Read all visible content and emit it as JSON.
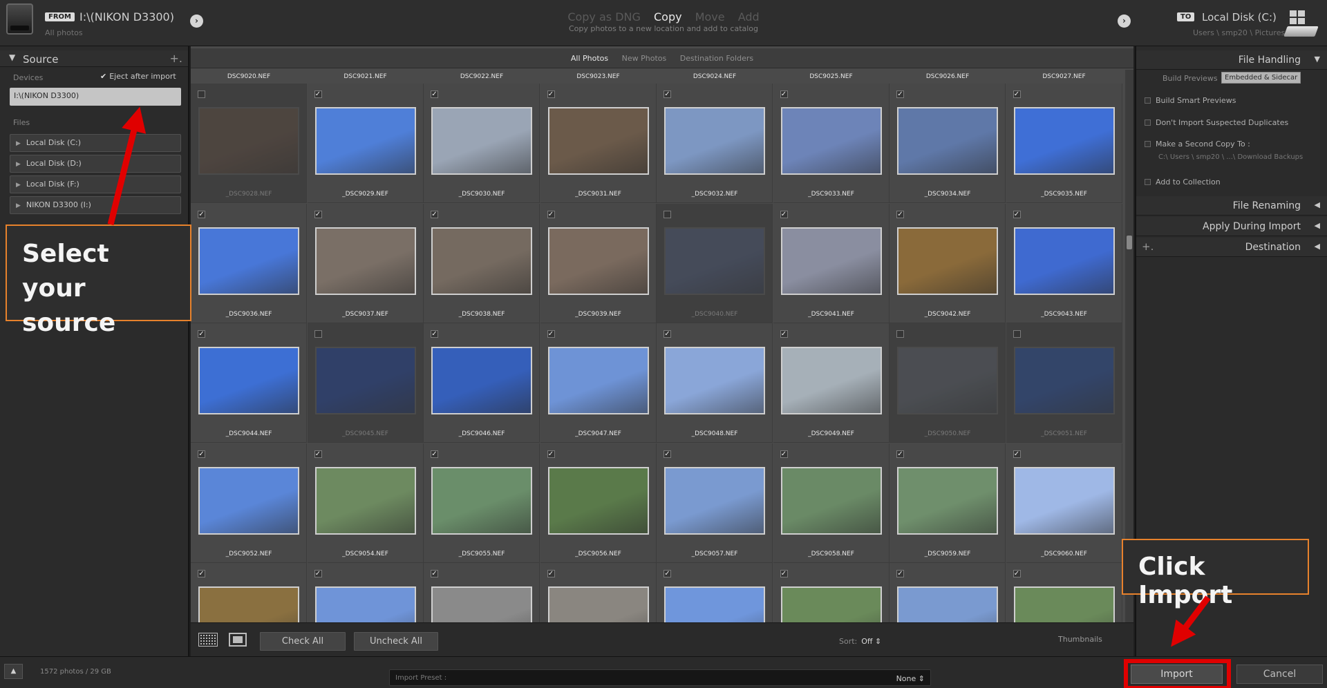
{
  "header": {
    "from_badge": "FROM",
    "from_path": "I:\\(NIKON D3300)",
    "from_sub": "All photos",
    "modes": [
      {
        "label": "Copy as DNG",
        "active": false
      },
      {
        "label": "Copy",
        "active": true
      },
      {
        "label": "Move",
        "active": false
      },
      {
        "label": "Add",
        "active": false
      }
    ],
    "mode_description": "Copy photos to a new location and add to catalog",
    "to_badge": "TO",
    "to_path": "Local Disk (C:)",
    "to_sub": "Users \\ smp20 \\ Pictures"
  },
  "source_panel": {
    "title": "Source",
    "devices_label": "Devices",
    "eject_label": "Eject after import",
    "eject_checked": true,
    "selected_device": "I:\\(NIKON D3300)",
    "files_label": "Files",
    "files": [
      "Local Disk (C:)",
      "Local Disk (D:)",
      "Local Disk (F:)",
      "NIKON D3300 (I:)"
    ]
  },
  "filter_tabs": [
    {
      "label": "All Photos",
      "active": true
    },
    {
      "label": "New Photos",
      "active": false
    },
    {
      "label": "Destination Folders",
      "active": false
    }
  ],
  "grid": {
    "top_row_names": [
      "DSC9020.NEF",
      "DSC9021.NEF",
      "DSC9022.NEF",
      "DSC9023.NEF",
      "DSC9024.NEF",
      "DSC9025.NEF",
      "DSC9026.NEF",
      "DSC9027.NEF"
    ],
    "rows": [
      [
        {
          "name": "_DSC9028.NEF",
          "checked": false,
          "color": "#5a4a40"
        },
        {
          "name": "_DSC9029.NEF",
          "checked": true,
          "color": "#4f7fd8"
        },
        {
          "name": "_DSC9030.NEF",
          "checked": true,
          "color": "#9aa5b5"
        },
        {
          "name": "_DSC9031.NEF",
          "checked": true,
          "color": "#6b5a4a"
        },
        {
          "name": "_DSC9032.NEF",
          "checked": true,
          "color": "#7d97c2"
        },
        {
          "name": "_DSC9033.NEF",
          "checked": true,
          "color": "#6d84b8"
        },
        {
          "name": "_DSC9034.NEF",
          "checked": true,
          "color": "#5f78a8"
        },
        {
          "name": "_DSC9035.NEF",
          "checked": true,
          "color": "#3f6fd6"
        }
      ],
      [
        {
          "name": "_DSC9036.NEF",
          "checked": true,
          "color": "#4877d8"
        },
        {
          "name": "_DSC9037.NEF",
          "checked": true,
          "color": "#7a6f66"
        },
        {
          "name": "_DSC9038.NEF",
          "checked": true,
          "color": "#756a60"
        },
        {
          "name": "_DSC9039.NEF",
          "checked": true,
          "color": "#7a6a5e"
        },
        {
          "name": "_DSC9040.NEF",
          "checked": false,
          "color": "#4a5570"
        },
        {
          "name": "_DSC9041.NEF",
          "checked": true,
          "color": "#8a8ea0"
        },
        {
          "name": "_DSC9042.NEF",
          "checked": true,
          "color": "#8a6a3a"
        },
        {
          "name": "_DSC9043.NEF",
          "checked": true,
          "color": "#3f6ad0"
        }
      ],
      [
        {
          "name": "_DSC9044.NEF",
          "checked": true,
          "color": "#3d6fd4"
        },
        {
          "name": "_DSC9045.NEF",
          "checked": false,
          "color": "#24418a"
        },
        {
          "name": "_DSC9046.NEF",
          "checked": true,
          "color": "#355fba"
        },
        {
          "name": "_DSC9047.NEF",
          "checked": true,
          "color": "#6e93d6"
        },
        {
          "name": "_DSC9048.NEF",
          "checked": true,
          "color": "#8aa6d8"
        },
        {
          "name": "_DSC9049.NEF",
          "checked": true,
          "color": "#a6b0b8"
        },
        {
          "name": "_DSC9050.NEF",
          "checked": false,
          "color": "#555a62"
        },
        {
          "name": "_DSC9051.NEF",
          "checked": false,
          "color": "#2a4a8c"
        }
      ],
      [
        {
          "name": "_DSC9052.NEF",
          "checked": true,
          "color": "#5a86d8"
        },
        {
          "name": "_DSC9054.NEF",
          "checked": true,
          "color": "#6d8a60"
        },
        {
          "name": "_DSC9055.NEF",
          "checked": true,
          "color": "#6a8e6a"
        },
        {
          "name": "_DSC9056.NEF",
          "checked": true,
          "color": "#5a7a4a"
        },
        {
          "name": "_DSC9057.NEF",
          "checked": true,
          "color": "#7a9ad0"
        },
        {
          "name": "_DSC9058.NEF",
          "checked": true,
          "color": "#6a8a66"
        },
        {
          "name": "_DSC9059.NEF",
          "checked": true,
          "color": "#6f8f6c"
        },
        {
          "name": "_DSC9060.NEF",
          "checked": true,
          "color": "#9fb8e6"
        }
      ],
      [
        {
          "name": "",
          "checked": true,
          "color": "#8a7040"
        },
        {
          "name": "",
          "checked": true,
          "color": "#6f94d8"
        },
        {
          "name": "",
          "checked": true,
          "color": "#8a8a8a"
        },
        {
          "name": "",
          "checked": true,
          "color": "#8a8680"
        },
        {
          "name": "",
          "checked": true,
          "color": "#6f96dc"
        },
        {
          "name": "",
          "checked": true,
          "color": "#6a8a5a"
        },
        {
          "name": "",
          "checked": true,
          "color": "#7a9ad0"
        },
        {
          "name": "",
          "checked": true,
          "color": "#6a8a5a"
        }
      ]
    ]
  },
  "toolbar": {
    "check_all": "Check All",
    "uncheck_all": "Uncheck All",
    "sort_label": "Sort:",
    "sort_value": "Off ⇕",
    "thumbnails_label": "Thumbnails"
  },
  "right_panel": {
    "file_handling": "File Handling",
    "build_previews_label": "Build Previews",
    "build_previews_value": "Embedded & Sidecar",
    "build_smart_previews": "Build Smart Previews",
    "dont_import_duplicates": "Don't Import Suspected Duplicates",
    "second_copy": "Make a Second Copy To :",
    "second_copy_path": "C:\\ Users \\ smp20 \\ ...\\ Download Backups",
    "add_to_collection": "Add to Collection",
    "file_renaming": "File Renaming",
    "apply_during_import": "Apply During Import",
    "destination": "Destination"
  },
  "bottom": {
    "count": "1572 photos / 29 GB",
    "preset_label": "Import Preset :",
    "preset_value": "None ⇕",
    "import": "Import",
    "cancel": "Cancel"
  },
  "annotations": {
    "select_source": "Select your source",
    "click_import": "Click Import"
  },
  "colors": {
    "accent_arrow": "#e00000",
    "callout_border": "#e8822c"
  }
}
